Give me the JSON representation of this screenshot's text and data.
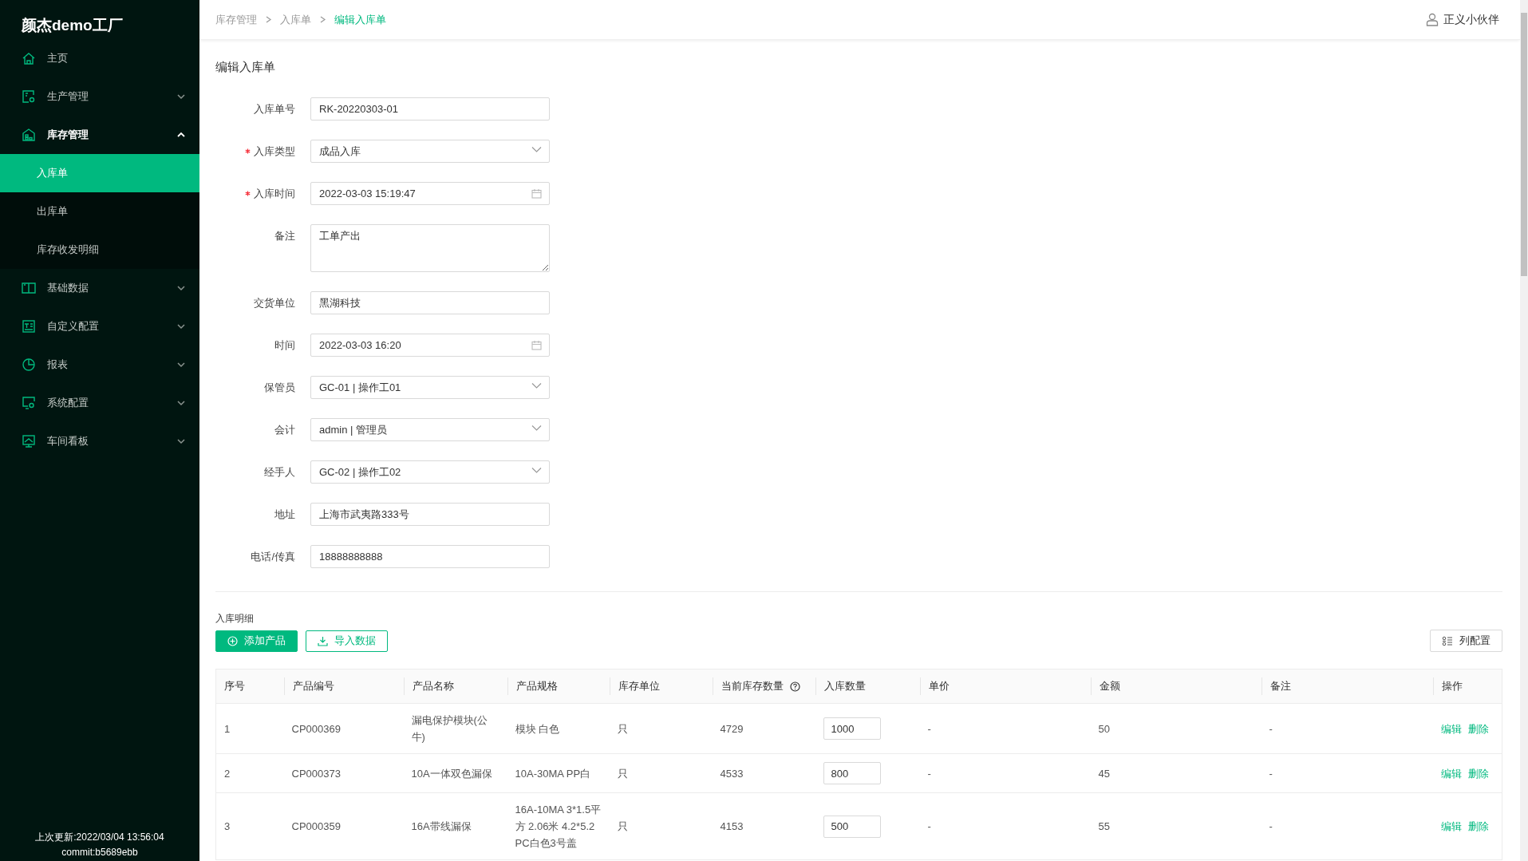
{
  "app": {
    "logo": "颜杰demo工厂",
    "last_update": "上次更新:2022/03/04 13:56:04",
    "commit": "commit:b5689ebb"
  },
  "sidebar": {
    "items": [
      {
        "label": "主页"
      },
      {
        "label": "生产管理",
        "expanded": false
      },
      {
        "label": "库存管理",
        "expanded": true,
        "children": [
          {
            "label": "入库单",
            "selected": true
          },
          {
            "label": "出库单",
            "selected": false
          },
          {
            "label": "库存收发明细",
            "selected": false
          }
        ]
      },
      {
        "label": "基础数据",
        "expanded": false
      },
      {
        "label": "自定义配置",
        "expanded": false
      },
      {
        "label": "报表",
        "expanded": false
      },
      {
        "label": "系统配置",
        "expanded": false
      },
      {
        "label": "车间看板",
        "expanded": false
      }
    ]
  },
  "header": {
    "breadcrumb": [
      "库存管理",
      "入库单",
      "编辑入库单"
    ],
    "user": "正义小伙伴"
  },
  "page_title": "编辑入库单",
  "form": {
    "fields": [
      {
        "kind": "text",
        "label": "入库单号",
        "required": false,
        "value": "RK-20220303-01"
      },
      {
        "kind": "select",
        "label": "入库类型",
        "required": true,
        "value": "成品入库"
      },
      {
        "kind": "date",
        "label": "入库时间",
        "required": true,
        "value": "2022-03-03 15:19:47"
      },
      {
        "kind": "textarea",
        "label": "备注",
        "required": false,
        "value": "工单产出"
      },
      {
        "kind": "text",
        "label": "交货单位",
        "required": false,
        "value": "黑湖科技"
      },
      {
        "kind": "date",
        "label": "时间",
        "required": false,
        "value": "2022-03-03 16:20"
      },
      {
        "kind": "select",
        "label": "保管员",
        "required": false,
        "value": "GC-01 | 操作工01"
      },
      {
        "kind": "select",
        "label": "会计",
        "required": false,
        "value": "admin | 管理员"
      },
      {
        "kind": "select",
        "label": "经手人",
        "required": false,
        "value": "GC-02 | 操作工02"
      },
      {
        "kind": "text",
        "label": "地址",
        "required": false,
        "value": "上海市武夷路333号"
      },
      {
        "kind": "text",
        "label": "电话/传真",
        "required": false,
        "value": "18888888888"
      }
    ]
  },
  "details": {
    "title": "入库明细",
    "buttons": [
      {
        "kind": "primary",
        "label": "添加产品"
      },
      {
        "kind": "outline",
        "label": "导入数据"
      }
    ],
    "column_config": "列配置",
    "table": {
      "columns": [
        {
          "label": "序号",
          "help": false
        },
        {
          "label": "产品编号",
          "help": false
        },
        {
          "label": "产品名称",
          "help": false
        },
        {
          "label": "产品规格",
          "help": false
        },
        {
          "label": "库存单位",
          "help": false
        },
        {
          "label": "当前库存数量",
          "help": true
        },
        {
          "label": "入库数量",
          "help": false
        },
        {
          "label": "单价",
          "help": false
        },
        {
          "label": "金额",
          "help": false
        },
        {
          "label": "备注",
          "help": false
        },
        {
          "label": "操作",
          "help": false
        }
      ],
      "rows": [
        {
          "index": "1",
          "code": "CP000369",
          "name": "漏电保护模块(公牛)",
          "spec": "模块 白色",
          "unit": "只",
          "stock": "4729",
          "quantity": "1000",
          "price": "-",
          "amount": "50",
          "remark": "-",
          "actions": [
            "编辑",
            "删除"
          ]
        },
        {
          "index": "2",
          "code": "CP000373",
          "name": "10A一体双色漏保",
          "spec": "10A-30MA PP白",
          "unit": "只",
          "stock": "4533",
          "quantity": "800",
          "price": "-",
          "amount": "45",
          "remark": "-",
          "actions": [
            "编辑",
            "删除"
          ]
        },
        {
          "index": "3",
          "code": "CP000359",
          "name": "16A带线漏保",
          "spec": "16A-10MA 3*1.5平方 2.06米 4.2*5.2 PC白色3号盖",
          "unit": "只",
          "stock": "4153",
          "quantity": "500",
          "price": "-",
          "amount": "55",
          "remark": "-",
          "actions": [
            "编辑",
            "删除"
          ]
        }
      ]
    }
  }
}
